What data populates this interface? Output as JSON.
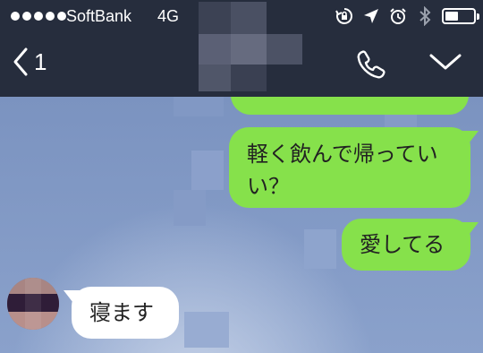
{
  "status_bar": {
    "carrier": "SoftBank",
    "network": "4G",
    "signal_dots": 5,
    "battery_level": 0.45,
    "icons": [
      "orientation-lock-icon",
      "location-arrow-icon",
      "alarm-clock-icon",
      "bluetooth-icon",
      "battery-icon"
    ]
  },
  "header": {
    "back_count": "1",
    "call_icon": "phone-icon",
    "menu_icon": "chevron-down-icon",
    "bar_color": "#262d3d"
  },
  "messages": [
    {
      "side": "sent",
      "text": ""
    },
    {
      "side": "sent",
      "line1": "軽く飲んで帰ってい",
      "line2": "い？"
    },
    {
      "side": "sent",
      "text": "愛してる"
    },
    {
      "side": "received",
      "text": "寝ます"
    }
  ],
  "colors": {
    "sent_bubble": "#86e14b",
    "received_bubble": "#ffffff",
    "chat_background": "#7f97c2"
  }
}
